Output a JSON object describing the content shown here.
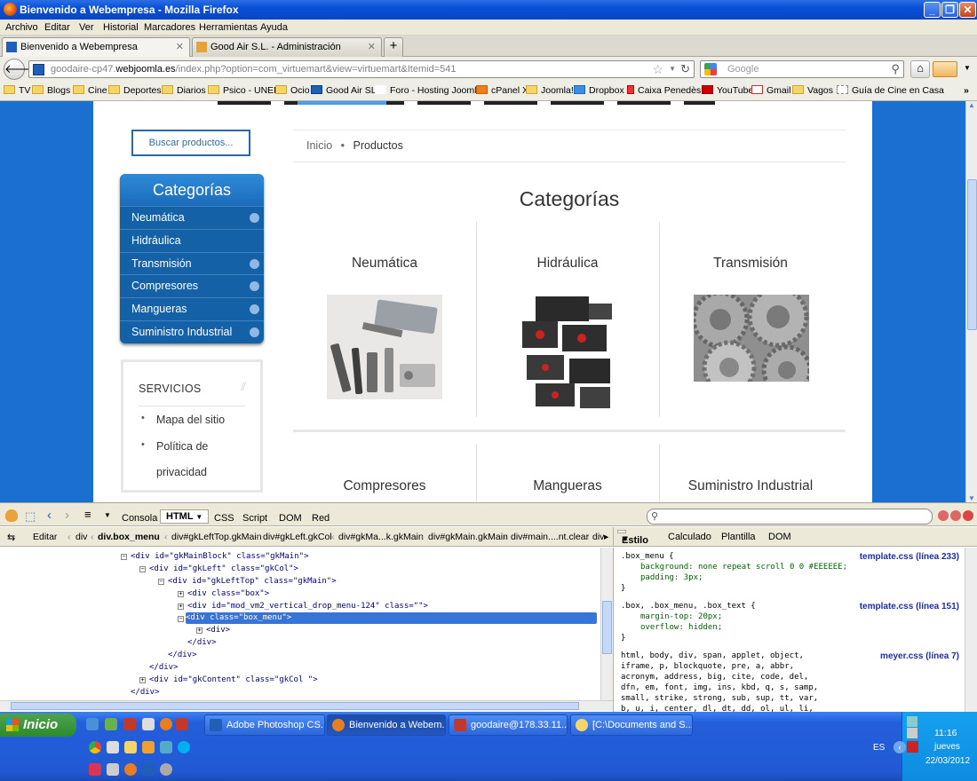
{
  "window": {
    "title": "Bienvenido a Webempresa - Mozilla Firefox",
    "min": "_",
    "max": "❐",
    "close": "✕"
  },
  "menubar": [
    "Archivo",
    "Editar",
    "Ver",
    "Historial",
    "Marcadores",
    "Herramientas",
    "Ayuda"
  ],
  "tabs": [
    {
      "label": "Bienvenido a Webempresa",
      "close": "✕"
    },
    {
      "label": "Good Air S.L. - Administración",
      "close": "✕"
    }
  ],
  "newtab": "+",
  "nav": {
    "url_domain_prefix": "goodaire-cp47.",
    "url_domain": "webjoomla.es",
    "url_path": "/index.php?option=com_virtuemart&view=virtuemart&Itemid=541",
    "search_placeholder": "Google"
  },
  "bookmarks": [
    "TV",
    "Blogs",
    "Cine",
    "Deportes",
    "Diarios",
    "Psico - UNED",
    "Ocio",
    "Good Air SL",
    "Foro - Hosting Joomla",
    "cPanel X",
    "Joomla!",
    "Dropbox",
    "Caixa Penedès",
    "YouTube",
    "Gmail",
    "Vagos",
    "Guía de Cine en Casa"
  ],
  "site": {
    "search_button": "Buscar productos...",
    "categories_title": "Categorías",
    "categories": [
      "Neumática",
      "Hidráulica",
      "Transmisión",
      "Compresores",
      "Mangueras",
      "Suministro Industrial"
    ],
    "services_title": "SERVICIOS",
    "services": [
      "Mapa del sitio",
      "Política de",
      "privacidad"
    ],
    "breadcrumb": {
      "home": "Inicio",
      "sep": "•",
      "current": "Productos"
    },
    "main_title": "Categorías",
    "grid": [
      "Neumática",
      "Hidráulica",
      "Transmisión",
      "Compresores",
      "Mangueras",
      "Suministro Industrial"
    ]
  },
  "firebug": {
    "tabs": [
      "Consola",
      "HTML",
      "CSS",
      "Script",
      "DOM",
      "Red"
    ],
    "edit": "Editar",
    "breadcrumb": [
      "div",
      "div.box_menu",
      "div#gkLeftTop.gkMain",
      "div#gkLeft.gkCol",
      "div#gkMa...k.gkMain",
      "div#gkMain.gkMain",
      "div#main....nt.clear",
      "div"
    ],
    "right_tabs": [
      "Estilo",
      "Calculado",
      "Plantilla",
      "DOM"
    ],
    "html_lines": [
      "<div id=\"gkMainBlock\" class=\"gkMain\">",
      "<div id=\"gkLeft\" class=\"gkCol\">",
      "<div id=\"gkLeftTop\" class=\"gkMain\">",
      "<div class=\"box\">",
      "<div id=\"mod_vm2_vertical_drop_menu-124\" class=\"\">",
      "<div class=\"box_menu\">",
      "<div>",
      "</div>",
      "</div>",
      "</div>",
      "<div id=\"gkContent\" class=\"gkCol \">",
      "</div>"
    ],
    "css_rules": [
      {
        "selector": ".box_menu {",
        "props": [
          "background: none repeat scroll 0 0 #EEEEEE;",
          "padding: 3px;"
        ],
        "source": "template.css (línea 233)"
      },
      {
        "selector": ".box, .box_menu, .box_text {",
        "props": [
          "margin-top: 20px;",
          "overflow: hidden;"
        ],
        "source": "template.css (línea 151)"
      },
      {
        "selector": "html, body, div, span, applet, object,",
        "props": [],
        "source": "meyer.css (línea 7)"
      }
    ],
    "css_more": [
      "iframe, p, blockquote, pre, a, abbr,",
      "acronym, address, big, cite, code, del,",
      "dfn, em, font, img, ins, kbd, q, s, samp,",
      "small, strike, strong, sub, sup, tt, var,",
      "b, u, i, center, dl, dt, dd, ol, ul, li,"
    ]
  },
  "taskbar": {
    "start": "Inicio",
    "tasks": [
      "Adobe Photoshop CS...",
      "Bienvenido a Webem...",
      "goodaire@178.33.11...",
      "[C:\\Documents and S..."
    ],
    "lang": "ES",
    "time": "11:16",
    "day": "jueves",
    "date": "22/03/2012"
  }
}
